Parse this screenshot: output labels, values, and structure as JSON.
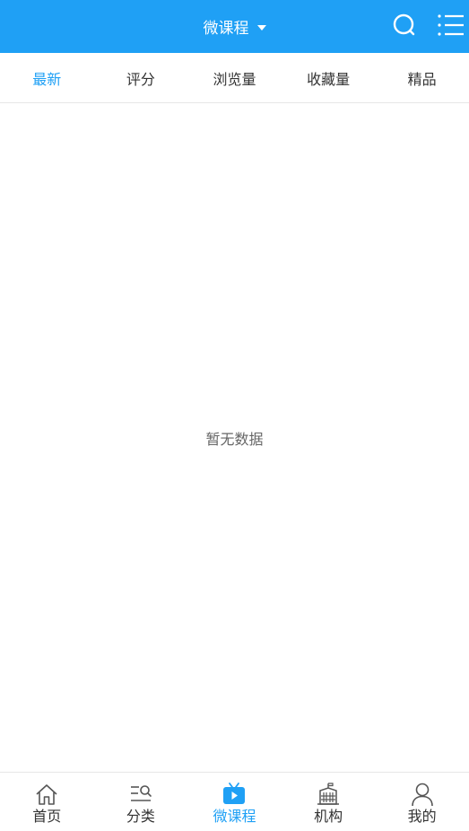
{
  "header": {
    "title": "微课程",
    "dropdown_icon": "caret-down-icon",
    "search_icon": "search-icon",
    "menu_icon": "list-menu-icon",
    "bg_color": "#1fa0f5"
  },
  "tabs": [
    {
      "label": "最新",
      "active": true
    },
    {
      "label": "评分",
      "active": false
    },
    {
      "label": "浏览量",
      "active": false
    },
    {
      "label": "收藏量",
      "active": false
    },
    {
      "label": "精品",
      "active": false
    }
  ],
  "empty_message": "暂无数据",
  "bottom_nav": [
    {
      "label": "首页",
      "icon": "home-icon",
      "active": false
    },
    {
      "label": "分类",
      "icon": "category-icon",
      "active": false
    },
    {
      "label": "微课程",
      "icon": "tv-play-icon",
      "active": true
    },
    {
      "label": "机构",
      "icon": "building-icon",
      "active": false
    },
    {
      "label": "我的",
      "icon": "user-icon",
      "active": false
    }
  ],
  "colors": {
    "accent": "#1fa0f5",
    "text": "#333333",
    "muted": "#666666"
  }
}
